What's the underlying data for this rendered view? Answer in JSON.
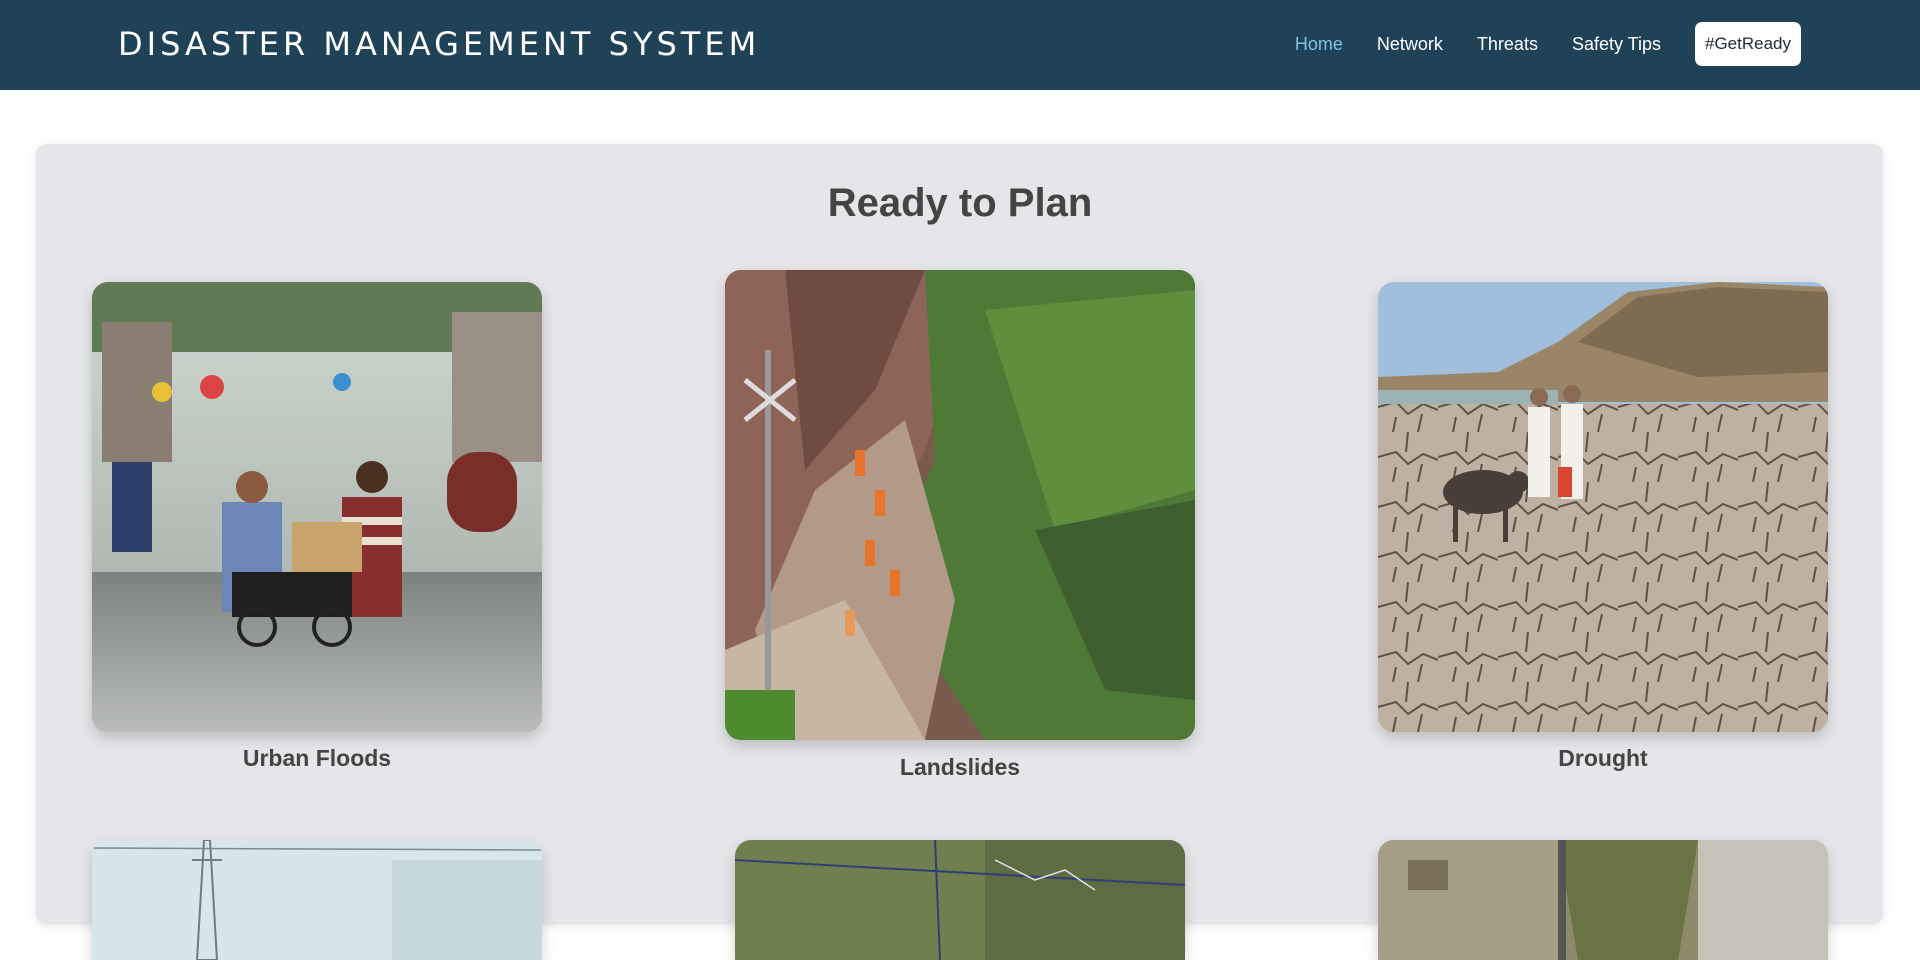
{
  "navbar": {
    "brand": "DISASTER MANAGEMENT SYSTEM",
    "links": [
      {
        "label": "Home",
        "active": true
      },
      {
        "label": "Network",
        "active": false
      },
      {
        "label": "Threats",
        "active": false
      },
      {
        "label": "Safety Tips",
        "active": false
      }
    ],
    "cta_label": "#GetReady"
  },
  "main": {
    "title": "Ready to Plan",
    "cards": [
      {
        "label": "Urban Floods",
        "image": "urban-floods-photo"
      },
      {
        "label": "Landslides",
        "image": "landslides-photo"
      },
      {
        "label": "Drought",
        "image": "drought-photo"
      },
      {
        "label": "",
        "image": "power-lines-photo"
      },
      {
        "label": "",
        "image": "satellite-map-photo"
      },
      {
        "label": "",
        "image": "hillside-town-photo"
      }
    ]
  },
  "colors": {
    "navbar_bg": "#1f4257",
    "nav_active": "#7ec3e6",
    "panel_bg": "#e5e6e9",
    "heading_text": "#444444"
  }
}
